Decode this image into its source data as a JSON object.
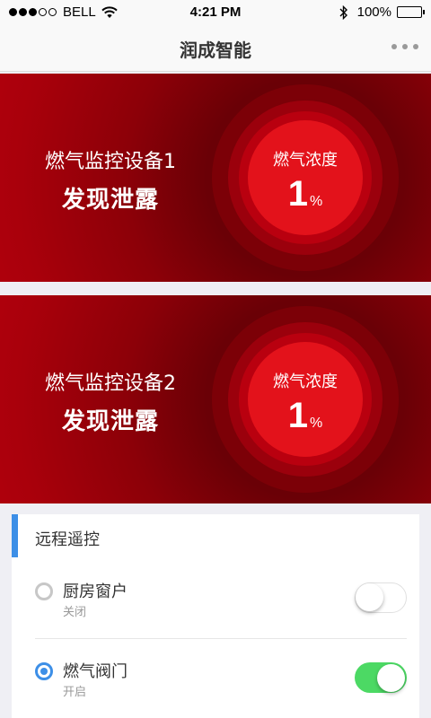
{
  "status_bar": {
    "signal_filled": 3,
    "signal_total": 5,
    "carrier": "BELL",
    "time": "4:21 PM",
    "battery_percent": "100%",
    "icons": [
      "signal-dots-icon",
      "wifi-icon",
      "bluetooth-icon",
      "battery-icon"
    ]
  },
  "nav": {
    "title": "润成智能",
    "more_icon": "more-dots-icon"
  },
  "alerts": [
    {
      "device_name": "燃气监控设备1",
      "status": "发现泄露",
      "gauge_label": "燃气浓度",
      "gauge_value": "1",
      "gauge_unit": "%"
    },
    {
      "device_name": "燃气监控设备2",
      "status": "发现泄露",
      "gauge_label": "燃气浓度",
      "gauge_value": "1",
      "gauge_unit": "%"
    }
  ],
  "remote": {
    "title": "远程遥控",
    "controls": [
      {
        "label": "厨房窗户",
        "state_text": "关闭",
        "on": false
      },
      {
        "label": "燃气阀门",
        "state_text": "开启",
        "on": true
      }
    ]
  },
  "colors": {
    "alert_red": "#e3121b",
    "accent_blue": "#3d8fe7",
    "toggle_on": "#4cd964"
  }
}
